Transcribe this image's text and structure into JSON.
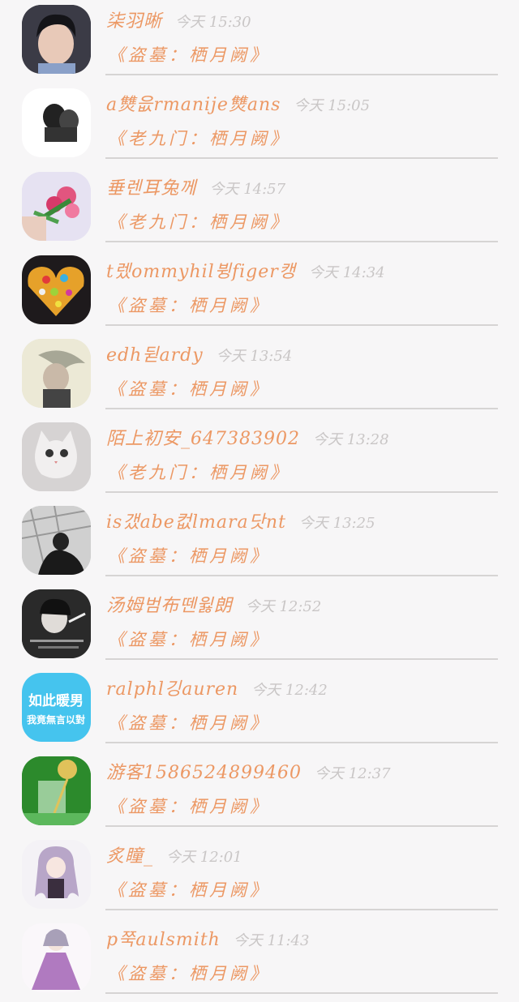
{
  "comments": [
    {
      "name": "柒羽晰",
      "time": "今天 15:30",
      "book": "《盗墓：栖月阙》",
      "avatar": "avatar-portrait-man",
      "color": "#2a2a33"
    },
    {
      "name": "a㸈읎rmanije㸈ans",
      "time": "今天 15:05",
      "book": "《老九门：栖月阙》",
      "avatar": "avatar-couple-bw",
      "color": "#ffffff"
    },
    {
      "name": "垂렌耳兔께",
      "time": "今天 14:57",
      "book": "《老九门：栖月阙》",
      "avatar": "avatar-flowers",
      "color": "#dcdcf0"
    },
    {
      "name": "t렜ommyhil뷩figer캥",
      "time": "今天 14:34",
      "book": "《盗墓：栖月阙》",
      "avatar": "avatar-heart",
      "color": "#1e1a1c"
    },
    {
      "name": "edh뒫ardy",
      "time": "今天 13:54",
      "book": "《盗墓：栖月阙》",
      "avatar": "avatar-woman-hair",
      "color": "#e6e2cc"
    },
    {
      "name": "陌上初安_647383902",
      "time": "今天 13:28",
      "book": "《老九门：栖月阙》",
      "avatar": "avatar-cat",
      "color": "#d2cfcf"
    },
    {
      "name": "is갰abe컶lmara닷nt",
      "time": "今天 13:25",
      "book": "《盗墓：栖月阙》",
      "avatar": "avatar-city-bw",
      "color": "#c8c8c8"
    },
    {
      "name": "汤姆범布뗀윓朗",
      "time": "今天 12:52",
      "book": "《盗墓：栖月阙》",
      "avatar": "avatar-woman-smoke",
      "color": "#3a3a3a"
    },
    {
      "name": "ralphl깅auren",
      "time": "今天 12:42",
      "book": "《盗墓：栖月阙》",
      "avatar": "avatar-text-card",
      "color": "#45c4ee",
      "avatar_text": [
        "如此暖男",
        "我竟無言以對"
      ]
    },
    {
      "name": "游客1586524899460",
      "time": "今天 12:37",
      "book": "《盗墓：栖月阙》",
      "avatar": "avatar-glass-green",
      "color": "#2e8f2a"
    },
    {
      "name": "炙瞳_",
      "time": "今天 12:01",
      "book": "《盗墓：栖月阙》",
      "avatar": "avatar-anime-girl",
      "color": "#f2f2f5"
    },
    {
      "name": "p쭉aulsmith",
      "time": "今天 11:43",
      "book": "《盗墓：栖月阙》",
      "avatar": "avatar-anime-dress",
      "color": "#f7f2f7"
    }
  ]
}
